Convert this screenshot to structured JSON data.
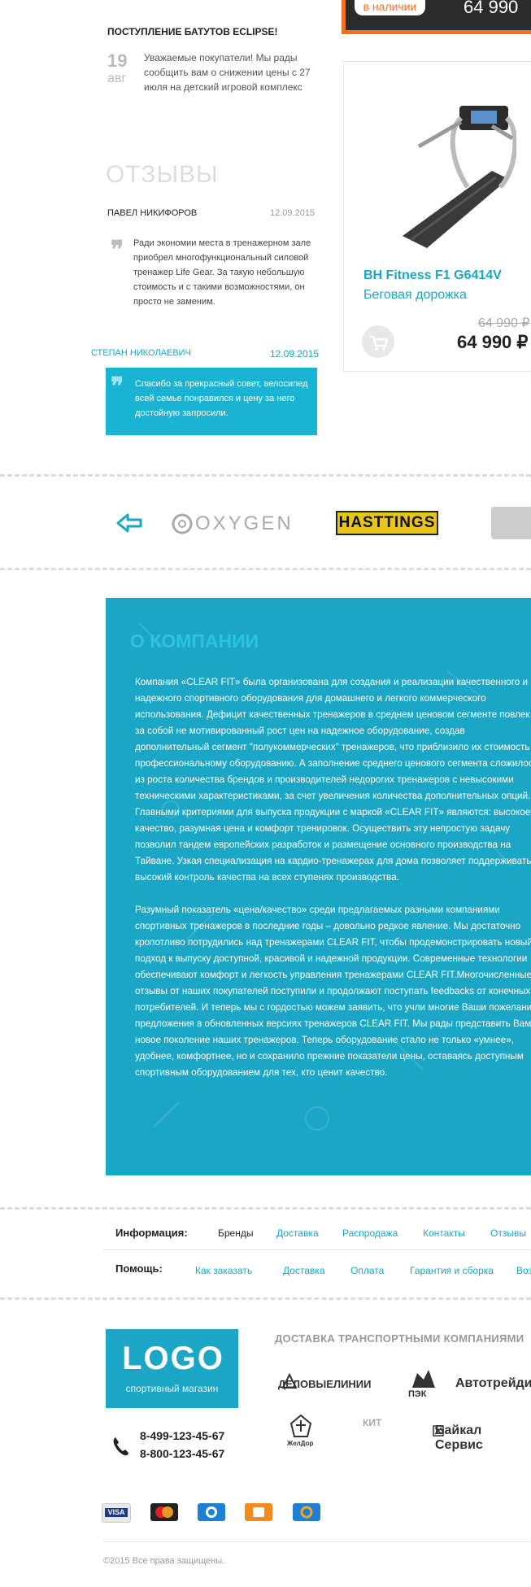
{
  "top_product": {
    "stock": "в наличии",
    "price": "64 990"
  },
  "news": {
    "title": "ПОСТУПЛЕНИЕ БАТУТОВ ECLIPSE!",
    "day": "19",
    "month": "авг",
    "text": "Уважаемые покупатели! Мы рады сообщить вам о снижении цены с 27 июля на детский игровой комплекс"
  },
  "reviews": {
    "heading": "ОТЗЫВЫ",
    "items": [
      {
        "name": "ПАВЕЛ НИКИФОРОВ",
        "date": "12.09.2015",
        "text": "Ради экономии места в тренажерном зале приобрел многофункциональный силовой тренажер Life Gear. За такую небольшую стоимость и с такими возможностями, он просто не заменим."
      },
      {
        "name": "СТЕПАН НИКОЛАЕВИЧ",
        "date": "12.09.2015",
        "text": "Спасибо за прекрасный совет, велосипед всей семье понравился и цену за него достойную запросили."
      }
    ]
  },
  "product": {
    "name": "BH Fitness F1 G6414V",
    "type": "Беговая дорожка",
    "old_price": "64 990",
    "price": "64 990",
    "currency": "₽"
  },
  "brands": [
    "OXYGEN",
    "HASTTINGS"
  ],
  "about": {
    "heading": "О КОМПАНИИ",
    "text": "Компания «CLEAR FIT» была организована для создания и реализации качественного и надежного спортивного оборудования для домашнего и легкого коммерческого использования. Дефицит качественных тренажеров в среднем ценовом сегменте повлек за собой не мотивированный рост цен на надежное оборудование, создав дополнительный сегмент \"полукоммерческих\" тренажеров, что приблизило их стоимость к профессиональному оборудованию. А заполнение среднего ценового сегмента сложилось из роста количества брендов и производителей недорогих тренажеров с невысокими техническими характеристиками, за счет увеличения количества дополнительных опций. Главными критериями для выпуска продукции с маркой «CLEAR FIT» являются: высокое качество, разумная цена и комфорт тренировок. Осуществить эту непростую задачу позволил тандем европейских разработок и размещение основного производства на Тайване. Узкая специализация на кардио-тренажерах для дома позволяет поддерживать высокий контроль качества на всех ступенях производства.\n\nРазумный показатель «цена/качество» среди предлагаемых разными компаниями спортивных тренажеров в последние годы – довольно редкое явление. Мы достаточно кропотливо потрудились над тренажерами CLEAR FIT, чтобы продемонстрировать новый подход к выпуску доступной, красивой и  надежной продукции. Современные технологии обеспечивают комфорт и легкость управления тренажерами CLEAR FIT.Многочисленные отзывы от наших покупателей  поступили и продолжают поступать feedbacks от конечных потребителей. И теперь мы с гордостью можем заявить, что учли многие Ваши пожелания предложения в обновленных версиях тренажеров CLEAR FIT. Мы рады представить Вам новое поколение наших тренажеров. Теперь оборудование стало не только «умнее», удобнее, комфортнее, но и сохранило прежние показатели цены, оставаясь доступным спортивным оборудованием для тех, кто ценит качество."
  },
  "footer_nav": {
    "info_label": "Информация:",
    "info_links": [
      "Бренды",
      "Доставка",
      "Распродажа",
      "Контакты",
      "Отзывы"
    ],
    "help_label": "Помощь:",
    "help_links": [
      "Как заказать",
      "Доставка",
      "Оплата",
      "Гарантия и сборка",
      "Воз"
    ]
  },
  "footer": {
    "logo": "LOGO",
    "logo_sub": "спортивный магазин",
    "phones": [
      "8-499-123-45-67",
      "8-800-123-45-67"
    ],
    "delivery_heading": "ДОСТАВКА ТРАНСПОРТНЫМИ КОМПАНИЯМИ",
    "delivery_companies": [
      "ДЕЛОВЫЕЛИНИИ",
      "ПЭК",
      "Автотрейдинг",
      "ЖелДор",
      "КИТ",
      "Байкал Сервис"
    ],
    "copyright": "©2015 Все права защищены."
  },
  "colors": {
    "accent": "#1aa6c4",
    "orange": "#f27021"
  }
}
